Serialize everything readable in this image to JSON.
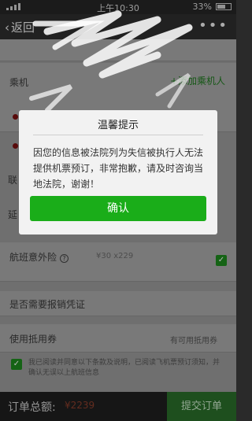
{
  "status_bar": {
    "time": "上午10:30",
    "battery": "33%"
  },
  "nav": {
    "back_label": "返回",
    "more_label": "•••"
  },
  "form": {
    "passenger_label": "乘机",
    "add_passenger": "+添加乘机人",
    "insurance_label": "航班意外险",
    "insurance_value": "¥30 x229",
    "voucher_question": "是否需要报销凭证",
    "use_voucher_label": "使用抵用券",
    "voucher_value": "有可用抵用券",
    "agreement": "我已阅读并同意以下条款及说明，已阅读飞机票预订须知，并确认无误以上航班信息"
  },
  "bottom": {
    "total_label": "订单总额:",
    "total_value": "¥2239",
    "submit_label": "提交订单"
  },
  "dialog": {
    "title": "温馨提示",
    "message": "因您的信息被法院列为失信被执行人无法提供机票预订，非常抱歉，请及时咨询当地法院，谢谢！",
    "confirm_label": "确认"
  },
  "colors": {
    "accent_green": "#1aad19",
    "dialog_bg": "#f2f2f2"
  }
}
